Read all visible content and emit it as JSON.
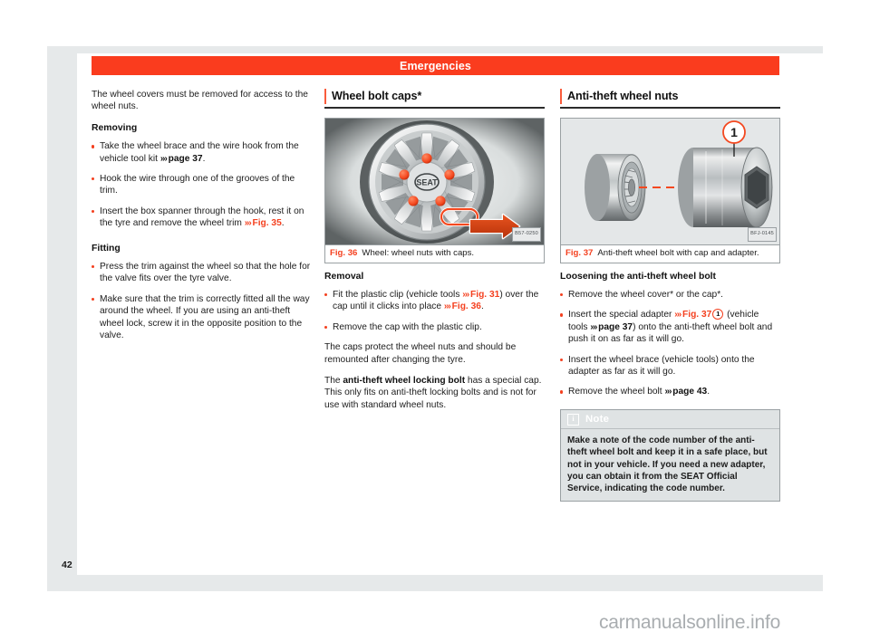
{
  "header": {
    "title": "Emergencies",
    "bar_color": "#fa3c1e"
  },
  "page": {
    "number": "42",
    "watermark": "carmanualsonline.info"
  },
  "column_left": {
    "intro": "The wheel covers must be removed for access to the wheel nuts.",
    "removing_heading": "Removing",
    "removing_bullets": [
      {
        "text_before": "Take the wheel brace and the wire hook from the vehicle tool kit ",
        "xref": "page 37",
        "xref_style": "dark",
        "text_after": "."
      },
      {
        "text_before": "Hook the wire through one of the grooves of the trim.",
        "xref": "",
        "xref_style": "",
        "text_after": ""
      },
      {
        "text_before": "Insert the box spanner through the hook, rest it on the tyre and remove the wheel trim ",
        "xref": "Fig. 35",
        "xref_style": "red",
        "text_after": "."
      }
    ],
    "fitting_heading": "Fitting",
    "fitting_bullets": [
      {
        "text_before": "Press the trim against the wheel so that the hole for the valve fits over the tyre valve.",
        "xref": "",
        "xref_style": "",
        "text_after": ""
      },
      {
        "text_before": "Make sure that the trim is correctly fitted all the way around the wheel. If you are using an anti-theft wheel lock, screw it in the opposite position to the valve.",
        "xref": "",
        "xref_style": "",
        "text_after": ""
      }
    ]
  },
  "column_middle": {
    "section_title": "Wheel bolt caps*",
    "figure": {
      "number": "Fig. 36",
      "caption": "Wheel: wheel nuts with caps.",
      "code": "B57-0250",
      "alt": "wheel-with-nut-caps-illustration"
    },
    "removal_heading": "Removal",
    "removal_bullets": [
      {
        "part1": "Fit the plastic clip (vehicle tools ",
        "xref1": "Fig. 31",
        "part2": ") over the cap until it clicks into place ",
        "xref2": "Fig. 36",
        "part3": "."
      },
      {
        "part1": "Remove the cap with the plastic clip.",
        "xref1": "",
        "part2": "",
        "xref2": "",
        "part3": ""
      }
    ],
    "para_1": "The caps protect the wheel nuts and should be remounted after changing the tyre.",
    "para_2_before": "The ",
    "para_2_bold": "anti-theft wheel locking bolt",
    "para_2_after": " has a special cap. This only fits on anti-theft locking bolts and is not for use with standard wheel nuts."
  },
  "column_right": {
    "section_title": "Anti-theft wheel nuts",
    "figure": {
      "number": "Fig. 37",
      "caption": "Anti-theft wheel bolt with cap and adapter.",
      "code": "BFJ-0145",
      "callout": "1",
      "alt": "anti-theft-wheel-bolt-cap-and-adapter-illustration"
    },
    "loosening_heading": "Loosening the anti-theft wheel bolt",
    "loosening_bullets": [
      {
        "part1": "Remove the wheel cover* or the cap*.",
        "xref1": "",
        "part2": "",
        "circled": "",
        "part3": "",
        "xref2": "",
        "part4": ""
      },
      {
        "part1": "Insert the special adapter ",
        "xref1": "Fig. 37",
        "part2": "",
        "circled": "1",
        "part3": " (vehicle tools ",
        "xref2": "page 37",
        "part4": ") onto the anti-theft wheel bolt and push it on as far as it will go."
      },
      {
        "part1": "Insert the wheel brace (vehicle tools) onto the adapter as far as it will go.",
        "xref1": "",
        "part2": "",
        "circled": "",
        "part3": "",
        "xref2": "",
        "part4": ""
      },
      {
        "part1": "Remove the wheel bolt ",
        "xref1": "",
        "part2": "",
        "circled": "",
        "part3": "",
        "xref2": "page 43",
        "part4": "."
      }
    ],
    "note": {
      "icon": "info-icon",
      "title": "Note",
      "body": "Make a note of the code number of the anti-theft wheel bolt and keep it in a safe place, but not in your vehicle. If you need a new adapter, you can obtain it from the SEAT Official Service, indicating the code number."
    }
  }
}
